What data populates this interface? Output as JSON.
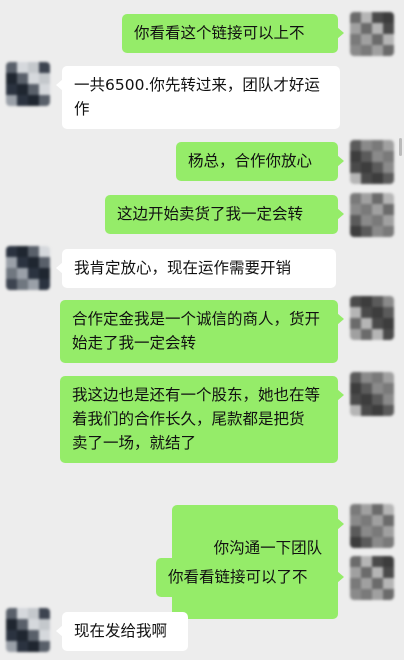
{
  "messages": [
    {
      "side": "right",
      "text": "你看看这个链接可以上不"
    },
    {
      "side": "left",
      "text": "一共6500.你先转过来，团队才好运作"
    },
    {
      "side": "right",
      "text": "杨总，合作你放心"
    },
    {
      "side": "right",
      "text": "这边开始卖货了我一定会转"
    },
    {
      "side": "left",
      "text": "我肯定放心，现在运作需要开销"
    },
    {
      "side": "right",
      "text": "合作定金我是一个诚信的商人，货开始走了我一定会转"
    },
    {
      "side": "right",
      "text": "我这边也是还有一个股东，她也在等着我们的合作长久，尾款都是把货\n卖了一场，就结了"
    },
    {
      "side": "right",
      "text": "你沟通一下团队",
      "icon": "handshake-emoji-icon"
    },
    {
      "side": "right",
      "text": "你看看链接可以了不"
    },
    {
      "side": "left",
      "text": "现在发给我啊"
    }
  ],
  "colors": {
    "background": "#ededed",
    "sent_bubble": "#95ec69",
    "received_bubble": "#ffffff"
  }
}
